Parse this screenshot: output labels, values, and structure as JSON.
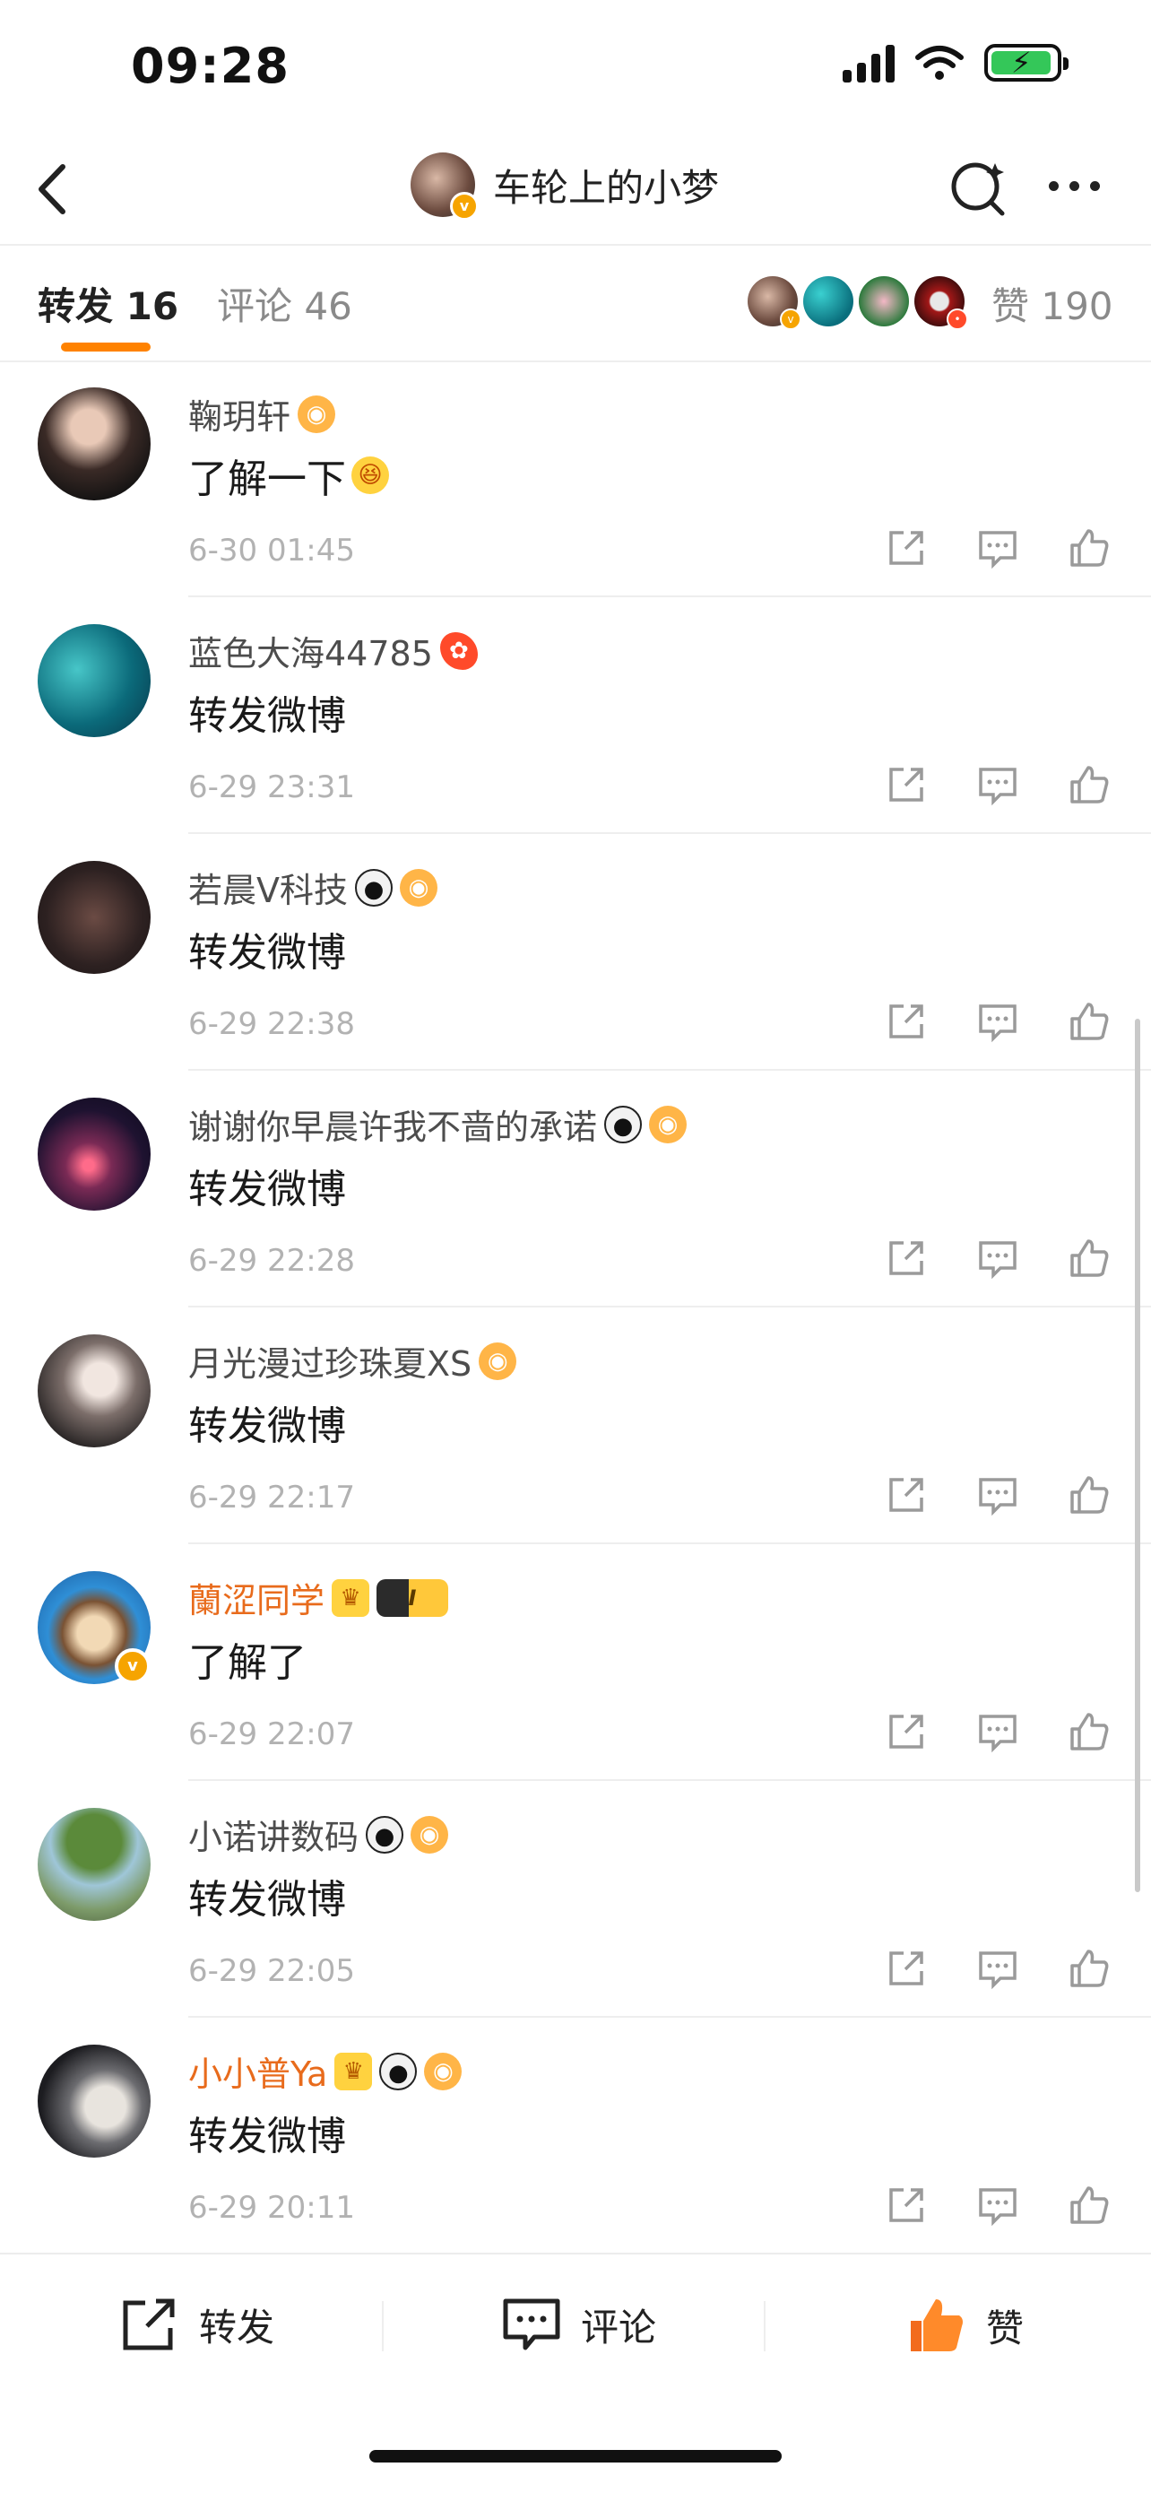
{
  "status_bar": {
    "time": "09:28"
  },
  "nav": {
    "title": "车轮上的小梦"
  },
  "tabs": {
    "repost": "转发 16",
    "comment": "评论 46",
    "like": "赞 190"
  },
  "colors": {
    "accent": "#ff8200",
    "vip_name": "#e86b1c",
    "verified": "#f6a400"
  },
  "reposts": [
    {
      "name": "鞠玥轩",
      "text": "了解一下",
      "time": "6-30 01:45",
      "vip": false
    },
    {
      "name": "蓝色大海44785",
      "text": "转发微博",
      "time": "6-29 23:31",
      "vip": false
    },
    {
      "name": "若晨V科技",
      "text": "转发微博",
      "time": "6-29 22:38",
      "vip": false
    },
    {
      "name": "谢谢你早晨许我不啬的承诺",
      "text": "转发微博",
      "time": "6-29 22:28",
      "vip": false
    },
    {
      "name": "月光漫过珍珠夏XS",
      "text": "转发微博",
      "time": "6-29 22:17",
      "vip": false
    },
    {
      "name": "蘭涩同学",
      "text": "了解了",
      "time": "6-29 22:07",
      "vip": true,
      "level_badge": "I"
    },
    {
      "name": "小诺讲数码",
      "text": "转发微博",
      "time": "6-29 22:05",
      "vip": false
    },
    {
      "name": "小小普Ya",
      "text": "转发微博",
      "time": "6-29 20:11",
      "vip": true
    }
  ],
  "toolbar": {
    "repost": "转发",
    "comment": "评论",
    "like": "赞"
  },
  "icons": [
    "back-icon",
    "search-icon",
    "more-icon",
    "share-icon",
    "comment-icon",
    "like-icon"
  ]
}
